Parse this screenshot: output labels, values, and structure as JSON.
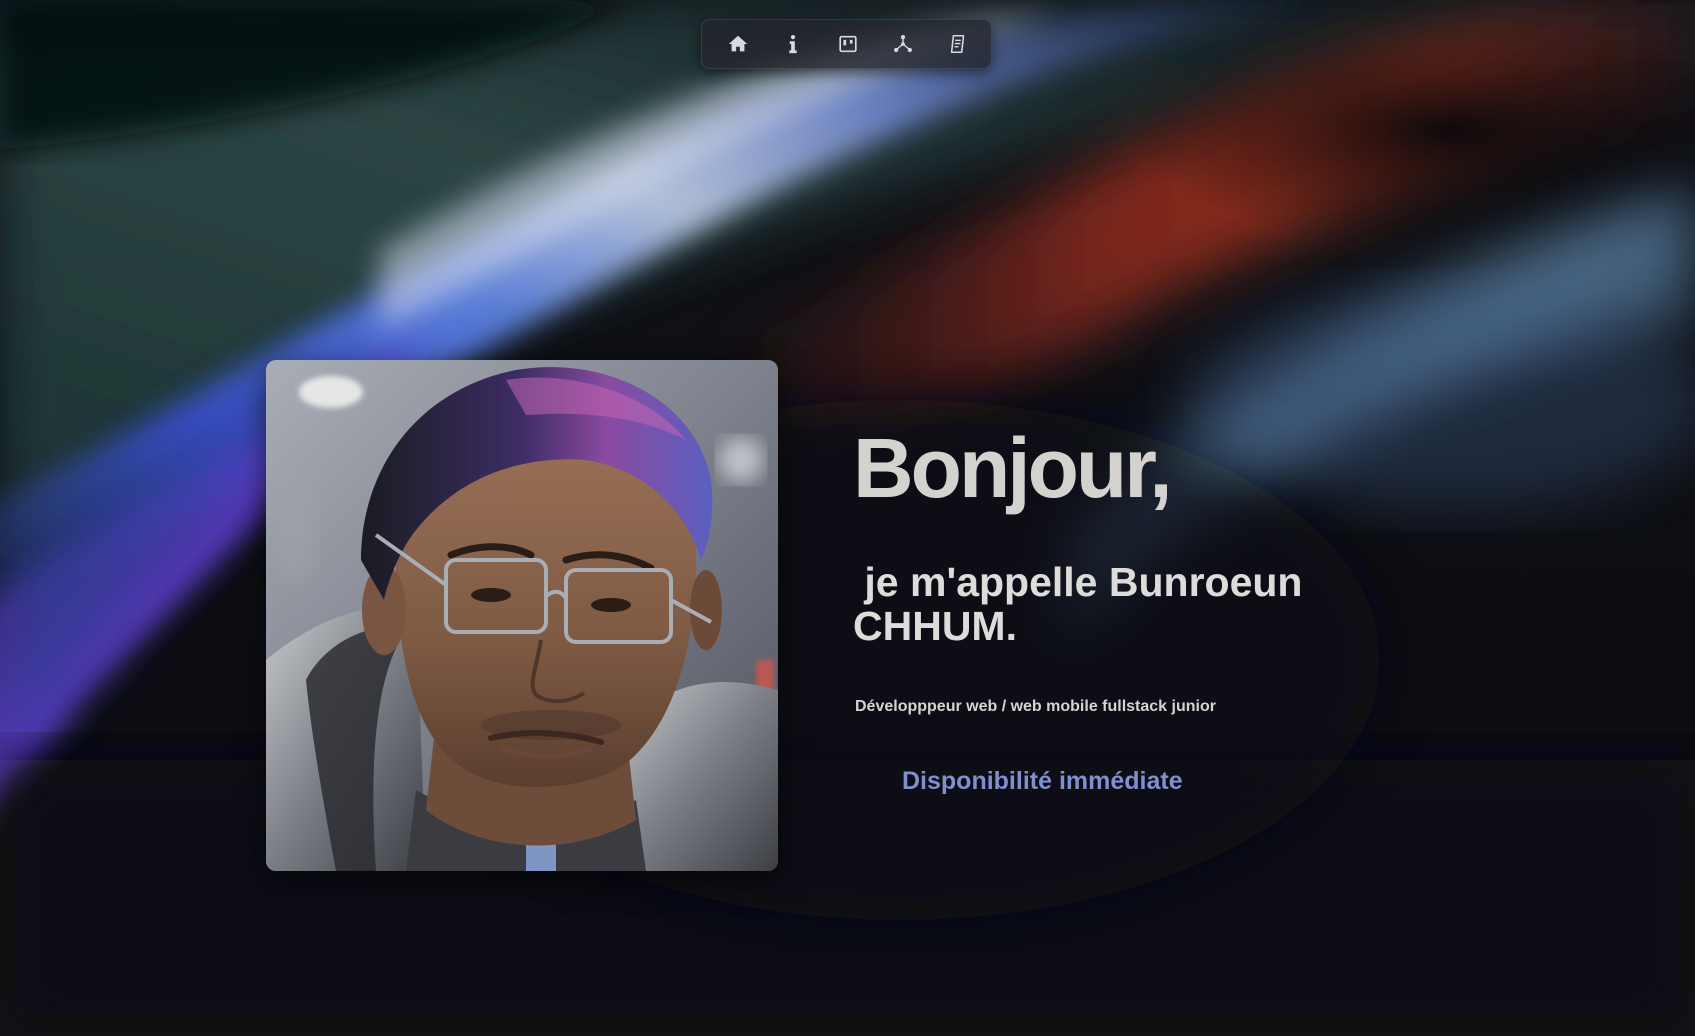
{
  "nav": {
    "items": [
      {
        "icon": "home-icon"
      },
      {
        "icon": "info-icon"
      },
      {
        "icon": "portfolio-icon"
      },
      {
        "icon": "network-icon"
      },
      {
        "icon": "document-icon"
      }
    ]
  },
  "hero": {
    "greeting": "Bonjour,",
    "name": " je m'appelle Bunroeun CHHUM.",
    "role": "Développpeur web / web mobile fullstack junior",
    "availability": "Disponibilité immédiate"
  },
  "colors": {
    "background": "#0d0e13",
    "greeting_text": "#d4d2cf",
    "name_text": "#dedcda",
    "availability_text": "#7f8fd0",
    "nav_icon": "#d9d9de"
  }
}
